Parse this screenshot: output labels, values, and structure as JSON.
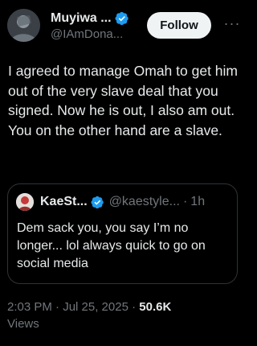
{
  "author": {
    "display_name": "Muyiwa ...",
    "handle": "@IAmDona...",
    "verified": true
  },
  "follow_label": "Follow",
  "more_label": "···",
  "tweet_text": "I agreed to manage Omah to get him out of the very slave deal that you signed. Now he is out, I also am out. You on the other hand are a slave.",
  "quote": {
    "display_name": "KaeSt...",
    "handle": "@kaestyle...",
    "separator": "·",
    "time": "1h",
    "text": "Dem sack you, you say I’m no longer... lol always quick to go on social media"
  },
  "meta": {
    "timestamp": "2:03 PM · Jul 25, 2025",
    "separator": "·",
    "views_count": "50.6K",
    "views_label": "Views"
  },
  "colors": {
    "background": "#000000",
    "text": "#e7e9ea",
    "muted": "#71767b",
    "verified": "#1d9bf0",
    "follow_bg": "#eff3f4",
    "border": "#2f3336"
  }
}
